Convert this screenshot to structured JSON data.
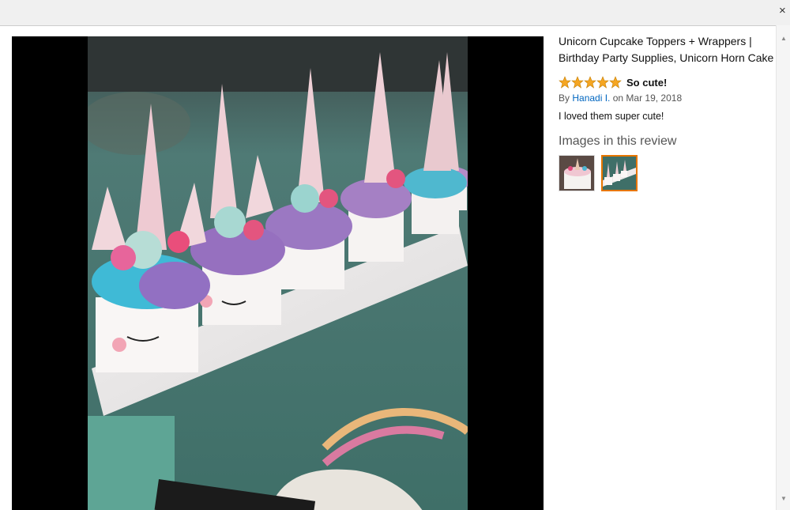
{
  "header": {
    "close_label": "×"
  },
  "review": {
    "product_title_line1": "Unicorn Cupcake Toppers + Wrappers |",
    "product_title_line2": "Birthday Party Supplies, Unicorn Horn Cake",
    "rating": 5,
    "rating_max": 5,
    "title": "So cute!",
    "by_prefix": "By",
    "author": "Hanadi I.",
    "date_text": "on Mar 19, 2018",
    "body": "I loved them super cute!",
    "images_heading": "Images in this review",
    "thumbnails": [
      {
        "icon": "cake-photo-icon",
        "selected": false
      },
      {
        "icon": "cupcakes-photo-icon",
        "selected": true
      }
    ]
  },
  "colors": {
    "star": "#f5a623",
    "link": "#0066c0",
    "selected_border": "#e77600",
    "viewer_bg": "#000000"
  },
  "scrollbar": {
    "up_icon": "▲",
    "down_icon": "▼"
  }
}
